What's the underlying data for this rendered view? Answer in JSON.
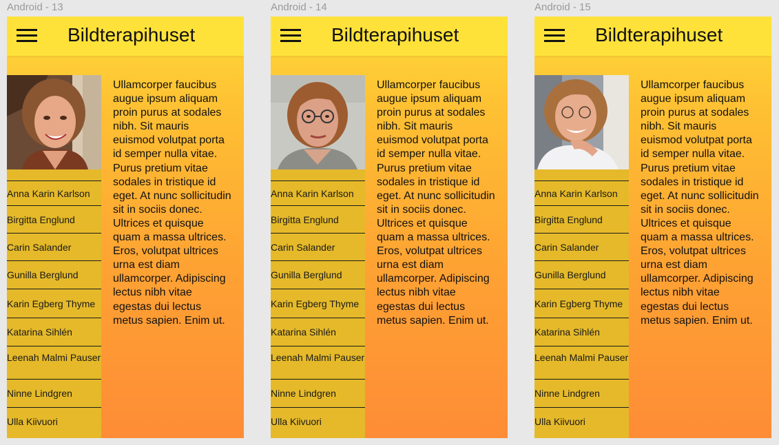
{
  "frames": [
    {
      "label": "Android - 13",
      "app_title": "Bildterapihuset",
      "body_text": "Ullamcorper faucibus augue ipsum aliquam proin purus at sodales nibh. Sit mauris euismod volutpat porta id semper nulla vitae. Purus pretium vitae sodales in tristique id eget. At nunc sollicitudin sit in sociis donec. Ultrices et quisque quam a massa ultrices. Eros, volutpat ultrices urna est diam ullamcorper. Adipiscing lectus nibh vitae egestas dui lectus metus sapien. Enim ut.",
      "nav": [
        "Anna Karin Karlson",
        "Birgitta Englund",
        "Carin Salander",
        "Gunilla Berglund",
        "Karin Egberg Thyme",
        "Katarina Sihlén",
        "Leenah Malmi Pauser",
        "Ninne Lindgren",
        "Ulla Kiivuori"
      ]
    },
    {
      "label": "Android - 14",
      "app_title": "Bildterapihuset",
      "body_text": "Ullamcorper faucibus augue ipsum aliquam proin purus at sodales nibh. Sit mauris euismod volutpat porta id semper nulla vitae. Purus pretium vitae sodales in tristique id eget. At nunc sollicitudin sit in sociis donec. Ultrices et quisque quam a massa ultrices. Eros, volutpat ultrices urna est diam ullamcorper. Adipiscing lectus nibh vitae egestas dui lectus metus sapien. Enim ut.",
      "nav": [
        "Anna Karin Karlson",
        "Birgitta Englund",
        "Carin Salander",
        "Gunilla Berglund",
        "Karin Egberg Thyme",
        "Katarina Sihlén",
        "Leenah Malmi Pauser",
        "Ninne Lindgren",
        "Ulla Kiivuori"
      ]
    },
    {
      "label": "Android - 15",
      "app_title": "Bildterapihuset",
      "body_text": "Ullamcorper faucibus augue ipsum aliquam proin purus at sodales nibh. Sit mauris euismod volutpat porta id semper nulla vitae. Purus pretium vitae sodales in tristique id eget. At nunc sollicitudin sit in sociis donec. Ultrices et quisque quam a massa ultrices. Eros, volutpat ultrices urna est diam ullamcorper. Adipiscing lectus nibh vitae egestas dui lectus metus sapien. Enim ut.",
      "nav": [
        "Anna Karin Karlson",
        "Birgitta Englund",
        "Carin Salander",
        "Gunilla Berglund",
        "Karin Egberg Thyme",
        "Katarina Sihlén",
        "Leenah Malmi Pauser",
        "Ninne Lindgren",
        "Ulla Kiivuori"
      ]
    }
  ],
  "icons": {
    "menu": "hamburger-menu-icon"
  },
  "colors": {
    "appbar": "#fee23a",
    "sidebar": "#e5b929",
    "gradient_top": "#fedb3a",
    "gradient_bottom": "#fe8c36"
  }
}
